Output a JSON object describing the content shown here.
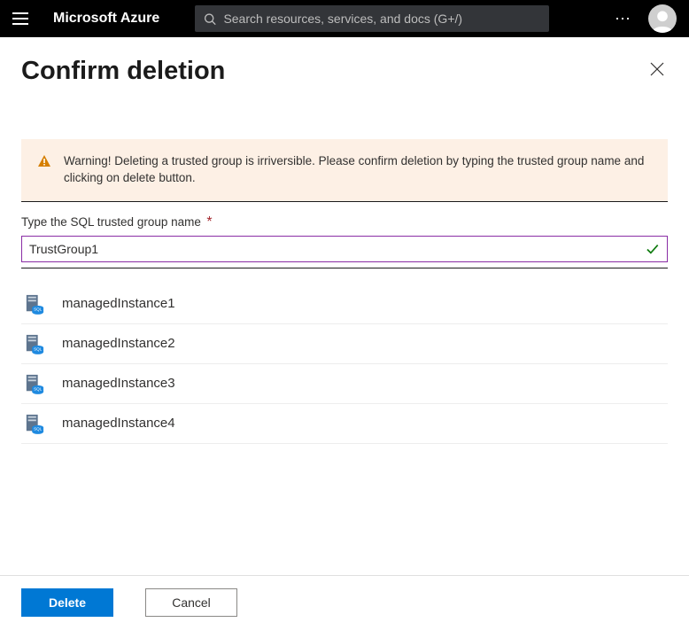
{
  "header": {
    "brand": "Microsoft Azure",
    "search_placeholder": "Search resources, services, and docs (G+/)"
  },
  "dialog": {
    "title": "Confirm deletion",
    "warning": "Warning! Deleting a trusted group is irriversible. Please confirm deletion by typing the trusted group name and clicking on delete button.",
    "field_label": "Type the SQL trusted group name",
    "input_value": "TrustGroup1",
    "instances": [
      {
        "name": "managedInstance1"
      },
      {
        "name": "managedInstance2"
      },
      {
        "name": "managedInstance3"
      },
      {
        "name": "managedInstance4"
      }
    ]
  },
  "footer": {
    "delete_label": "Delete",
    "cancel_label": "Cancel"
  }
}
